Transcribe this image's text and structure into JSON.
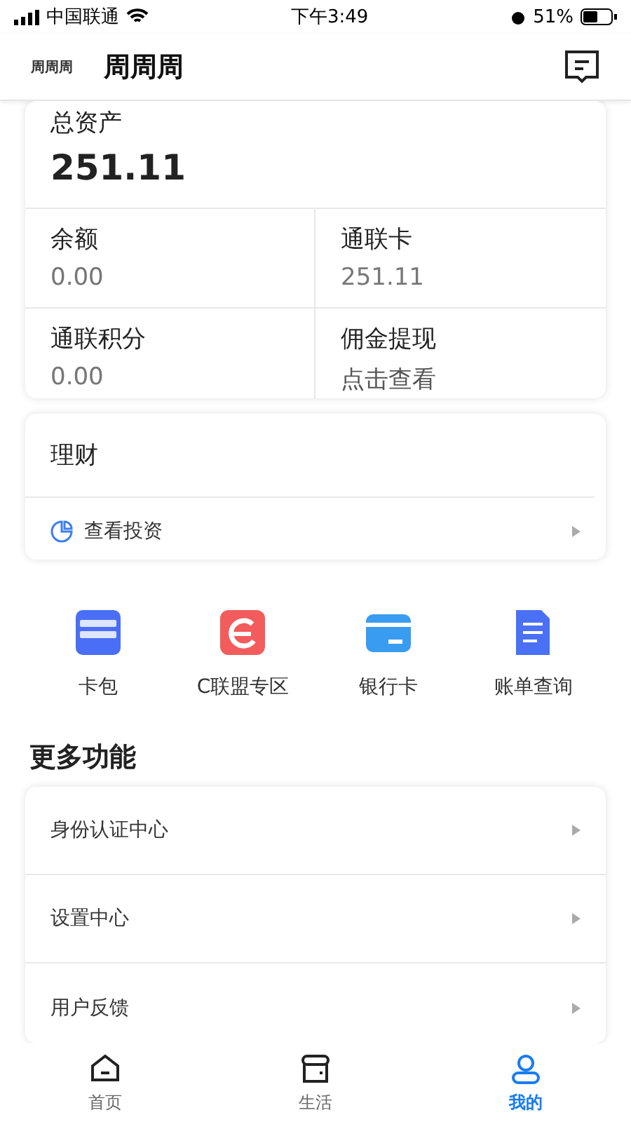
{
  "status_bar": {
    "carrier": "中国联通",
    "time": "下午3:49",
    "battery": "51%"
  },
  "header": {
    "logo": "周周周",
    "title": "周周周"
  },
  "assets": {
    "title": "总资产",
    "total": "251.11",
    "items": [
      {
        "label": "余额",
        "value": "0.00",
        "kind": "number"
      },
      {
        "label": "通联卡",
        "value": "251.11",
        "kind": "number"
      },
      {
        "label": "通联积分",
        "value": "0.00",
        "kind": "number"
      },
      {
        "label": "佣金提现",
        "value": "点击查看",
        "kind": "link"
      }
    ]
  },
  "finance": {
    "title": "理财",
    "link": "查看投资"
  },
  "shortcuts": [
    {
      "label": "卡包",
      "kind": "wallet"
    },
    {
      "label": "C联盟专区",
      "kind": "alliance"
    },
    {
      "label": "银行卡",
      "kind": "card"
    },
    {
      "label": "账单查询",
      "kind": "bill"
    }
  ],
  "more": {
    "title": "更多功能",
    "items": [
      "身份认证中心",
      "设置中心",
      "用户反馈"
    ]
  },
  "tab_bar": [
    {
      "label": "首页",
      "kind": "home",
      "selected": false
    },
    {
      "label": "生活",
      "kind": "shop",
      "selected": false
    },
    {
      "label": "我的",
      "kind": "user",
      "selected": true
    }
  ]
}
